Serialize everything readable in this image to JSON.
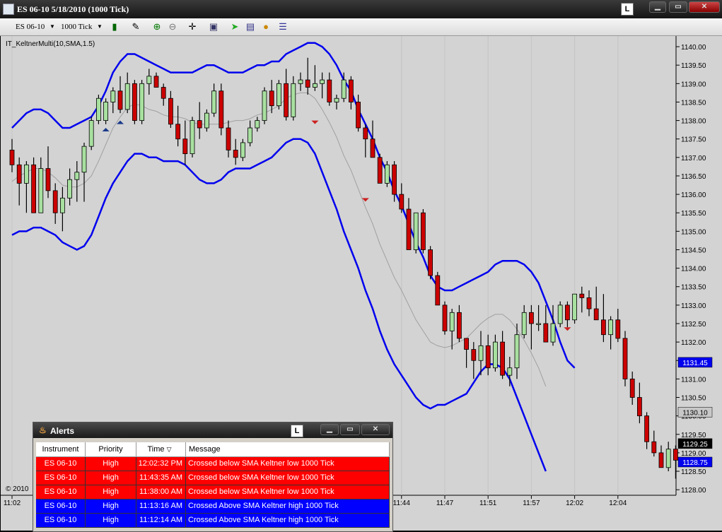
{
  "window": {
    "title": "ES 06-10  5/18/2010 (1000 Tick)",
    "lock_label": "L"
  },
  "toolbar": {
    "instrument": "ES 06-10",
    "interval": "1000 Tick"
  },
  "indicator_label": "IT_KeltnerMulti(10,SMA,1.5)",
  "copyright": "© 2010",
  "colors": {
    "up": "#a8e0a0",
    "down": "#cc0000",
    "band": "#0000ee",
    "mid": "#a0a0a0",
    "marker_up": "#1a3a8a",
    "marker_down": "#cc2222",
    "alert_red": "#ff0000",
    "alert_blue": "#0000ff",
    "chart_bg": "#d3d3d3"
  },
  "chart_data": {
    "type": "candlestick",
    "xlabel": "",
    "ylabel": "",
    "ylim": [
      1127.85,
      1140.25
    ],
    "y_ticks": [
      "1140.00",
      "1139.50",
      "1139.00",
      "1138.50",
      "1138.00",
      "1137.50",
      "1137.00",
      "1136.50",
      "1136.00",
      "1135.50",
      "1135.00",
      "1134.50",
      "1134.00",
      "1133.50",
      "1133.00",
      "1132.50",
      "1132.00",
      "1131.50",
      "1131.00",
      "1130.50",
      "1130.00",
      "1129.50",
      "1129.00",
      "1128.50",
      "1128.00"
    ],
    "x_ticks": [
      {
        "bar": 0,
        "label": "11:02"
      },
      {
        "bar": 54,
        "label": "11:44"
      },
      {
        "bar": 60,
        "label": "11:47"
      },
      {
        "bar": 66,
        "label": "11:51"
      },
      {
        "bar": 72,
        "label": "11:57"
      },
      {
        "bar": 78,
        "label": "12:02"
      },
      {
        "bar": 84,
        "label": "12:04"
      }
    ],
    "price_tags": [
      {
        "label": "1131.45",
        "value": 1131.45,
        "color": "#0000ee"
      },
      {
        "label": "1130.10",
        "value": 1130.1,
        "color": "#c8c8c8"
      },
      {
        "label": "1129.25",
        "value": 1129.25,
        "color": "#000000"
      },
      {
        "label": "1128.75",
        "value": 1128.75,
        "color": "#0000ee"
      }
    ],
    "ohlc": [
      [
        1137.2,
        1137.5,
        1136.6,
        1136.8
      ],
      [
        1136.8,
        1137.0,
        1135.7,
        1136.3
      ],
      [
        1136.3,
        1136.9,
        1135.5,
        1136.8
      ],
      [
        1136.8,
        1137.0,
        1135.5,
        1135.5
      ],
      [
        1135.5,
        1137.0,
        1135.5,
        1136.7
      ],
      [
        1136.7,
        1137.3,
        1135.9,
        1136.1
      ],
      [
        1136.1,
        1136.3,
        1135.2,
        1135.5
      ],
      [
        1135.5,
        1136.2,
        1135.0,
        1135.9
      ],
      [
        1135.9,
        1136.7,
        1135.7,
        1136.4
      ],
      [
        1136.4,
        1136.9,
        1135.8,
        1136.6
      ],
      [
        1136.6,
        1137.4,
        1135.8,
        1137.3
      ],
      [
        1137.3,
        1138.1,
        1137.2,
        1138.0
      ],
      [
        1138.0,
        1138.7,
        1137.9,
        1138.6
      ],
      [
        1138.0,
        1138.6,
        1137.9,
        1138.5
      ],
      [
        1138.5,
        1138.9,
        1138.2,
        1138.8
      ],
      [
        1138.8,
        1139.2,
        1138.2,
        1138.3
      ],
      [
        1138.3,
        1139.3,
        1138.2,
        1139.0
      ],
      [
        1139.0,
        1139.1,
        1137.9,
        1138.0
      ],
      [
        1138.0,
        1139.1,
        1137.9,
        1139.0
      ],
      [
        1139.0,
        1139.4,
        1138.7,
        1139.2
      ],
      [
        1139.2,
        1139.3,
        1138.9,
        1138.9
      ],
      [
        1138.9,
        1139.0,
        1138.4,
        1138.6
      ],
      [
        1138.6,
        1138.8,
        1137.8,
        1137.9
      ],
      [
        1137.9,
        1138.4,
        1137.3,
        1137.5
      ],
      [
        1137.5,
        1138.0,
        1136.8,
        1137.1
      ],
      [
        1137.1,
        1138.1,
        1137.0,
        1138.0
      ],
      [
        1138.0,
        1138.5,
        1137.5,
        1137.8
      ],
      [
        1137.8,
        1138.3,
        1137.7,
        1138.2
      ],
      [
        1138.2,
        1139.0,
        1138.1,
        1138.8
      ],
      [
        1138.8,
        1139.0,
        1137.6,
        1137.8
      ],
      [
        1137.8,
        1138.0,
        1137.0,
        1137.2
      ],
      [
        1137.2,
        1137.5,
        1136.8,
        1137.0
      ],
      [
        1137.0,
        1137.5,
        1136.9,
        1137.4
      ],
      [
        1137.4,
        1138.0,
        1137.3,
        1137.8
      ],
      [
        1137.8,
        1138.1,
        1137.7,
        1138.0
      ],
      [
        1138.0,
        1138.9,
        1137.9,
        1138.8
      ],
      [
        1138.8,
        1139.1,
        1138.2,
        1138.4
      ],
      [
        1138.4,
        1139.1,
        1138.3,
        1139.0
      ],
      [
        1139.0,
        1139.4,
        1138.0,
        1138.1
      ],
      [
        1138.1,
        1139.2,
        1138.0,
        1139.0
      ],
      [
        1139.0,
        1139.3,
        1138.8,
        1139.1
      ],
      [
        1139.1,
        1139.7,
        1138.7,
        1138.9
      ],
      [
        1138.9,
        1139.5,
        1138.8,
        1139.0
      ],
      [
        1139.0,
        1139.3,
        1138.6,
        1139.1
      ],
      [
        1139.1,
        1139.3,
        1138.4,
        1138.5
      ],
      [
        1138.5,
        1138.7,
        1138.3,
        1138.6
      ],
      [
        1138.6,
        1139.3,
        1138.5,
        1139.1
      ],
      [
        1139.1,
        1139.2,
        1138.3,
        1138.5
      ],
      [
        1138.5,
        1138.7,
        1137.7,
        1137.8
      ],
      [
        1137.8,
        1137.9,
        1137.0,
        1137.5
      ],
      [
        1137.5,
        1138.0,
        1137.0,
        1137.0
      ],
      [
        1137.0,
        1137.1,
        1136.3,
        1136.3
      ],
      [
        1136.3,
        1136.9,
        1136.2,
        1136.8
      ],
      [
        1136.8,
        1136.9,
        1135.8,
        1136.0
      ],
      [
        1136.0,
        1136.3,
        1135.5,
        1135.6
      ],
      [
        1135.6,
        1135.9,
        1134.5,
        1134.5
      ],
      [
        1134.5,
        1135.5,
        1134.4,
        1135.5
      ],
      [
        1135.5,
        1135.6,
        1134.4,
        1134.5
      ],
      [
        1134.5,
        1134.6,
        1133.7,
        1133.8
      ],
      [
        1133.8,
        1133.9,
        1133.0,
        1133.0
      ],
      [
        1133.0,
        1133.1,
        1132.2,
        1132.3
      ],
      [
        1132.3,
        1132.9,
        1131.8,
        1132.8
      ],
      [
        1132.8,
        1133.0,
        1132.0,
        1132.1
      ],
      [
        1132.1,
        1132.1,
        1131.3,
        1131.8
      ],
      [
        1131.8,
        1132.0,
        1131.0,
        1131.5
      ],
      [
        1131.5,
        1132.3,
        1131.1,
        1131.9
      ],
      [
        1131.9,
        1132.2,
        1131.1,
        1131.3
      ],
      [
        1131.3,
        1132.2,
        1131.2,
        1132.0
      ],
      [
        1132.0,
        1132.3,
        1131.0,
        1131.1
      ],
      [
        1131.1,
        1131.6,
        1130.8,
        1131.3
      ],
      [
        1131.3,
        1132.5,
        1131.0,
        1132.2
      ],
      [
        1132.2,
        1133.0,
        1132.1,
        1132.8
      ],
      [
        1132.8,
        1133.0,
        1131.8,
        1132.5
      ],
      [
        1132.5,
        1133.0,
        1132.3,
        1132.5
      ],
      [
        1132.5,
        1133.0,
        1132.0,
        1132.0
      ],
      [
        1132.0,
        1133.0,
        1131.9,
        1132.5
      ],
      [
        1132.5,
        1133.1,
        1132.4,
        1133.0
      ],
      [
        1133.0,
        1133.1,
        1132.4,
        1132.6
      ],
      [
        1132.6,
        1133.1,
        1132.5,
        1133.3
      ],
      [
        1133.3,
        1133.5,
        1132.8,
        1133.2
      ],
      [
        1133.2,
        1133.4,
        1132.7,
        1132.9
      ],
      [
        1132.9,
        1133.5,
        1132.7,
        1132.6
      ],
      [
        1132.6,
        1133.3,
        1132.0,
        1132.2
      ],
      [
        1132.2,
        1132.7,
        1131.8,
        1132.6
      ],
      [
        1132.6,
        1132.9,
        1132.0,
        1132.1
      ],
      [
        1132.1,
        1132.3,
        1130.8,
        1131.0
      ],
      [
        1131.0,
        1131.2,
        1130.3,
        1130.5
      ],
      [
        1130.5,
        1130.9,
        1129.8,
        1130.0
      ],
      [
        1130.0,
        1130.1,
        1129.1,
        1129.3
      ],
      [
        1129.3,
        1129.6,
        1128.9,
        1129.0
      ],
      [
        1129.0,
        1129.2,
        1128.6,
        1128.6
      ],
      [
        1128.6,
        1129.3,
        1128.5,
        1129.1
      ],
      [
        1129.1,
        1129.2,
        1128.3,
        1128.8
      ]
    ],
    "upper_band": [
      1137.8,
      1138.0,
      1138.2,
      1138.3,
      1138.3,
      1138.2,
      1138.0,
      1137.8,
      1137.8,
      1137.9,
      1138.0,
      1138.1,
      1138.4,
      1138.8,
      1139.3,
      1139.6,
      1139.8,
      1139.8,
      1139.7,
      1139.6,
      1139.5,
      1139.4,
      1139.3,
      1139.3,
      1139.3,
      1139.3,
      1139.4,
      1139.5,
      1139.5,
      1139.4,
      1139.3,
      1139.3,
      1139.3,
      1139.4,
      1139.5,
      1139.5,
      1139.6,
      1139.6,
      1139.8,
      1139.9,
      1140.0,
      1140.1,
      1140.1,
      1140.0,
      1139.8,
      1139.5,
      1139.1,
      1138.8,
      1138.3,
      1137.9,
      1137.5,
      1137.0,
      1136.6,
      1136.1,
      1135.7,
      1135.2,
      1134.7,
      1134.3,
      1133.8,
      1133.5,
      1133.4,
      1133.4,
      1133.5,
      1133.6,
      1133.7,
      1133.8,
      1133.9,
      1134.1,
      1134.2,
      1134.2,
      1134.2,
      1134.1,
      1133.9,
      1133.6,
      1133.1,
      1132.6,
      1132.0,
      1131.5,
      1131.3
    ],
    "lower_band": [
      1134.9,
      1135.0,
      1135.0,
      1135.1,
      1135.1,
      1135.0,
      1134.9,
      1134.7,
      1134.6,
      1134.5,
      1134.6,
      1134.9,
      1135.4,
      1135.9,
      1136.3,
      1136.6,
      1136.9,
      1137.1,
      1137.1,
      1137.0,
      1137.0,
      1136.9,
      1136.9,
      1136.9,
      1136.8,
      1136.6,
      1136.4,
      1136.3,
      1136.3,
      1136.4,
      1136.6,
      1136.7,
      1136.7,
      1136.7,
      1136.8,
      1136.9,
      1137.0,
      1137.2,
      1137.4,
      1137.5,
      1137.5,
      1137.4,
      1137.1,
      1136.6,
      1136.1,
      1135.6,
      1135.0,
      1134.5,
      1134.0,
      1133.4,
      1132.9,
      1132.3,
      1131.8,
      1131.4,
      1131.1,
      1130.8,
      1130.5,
      1130.3,
      1130.2,
      1130.3,
      1130.3,
      1130.4,
      1130.5,
      1130.6,
      1130.9,
      1131.2,
      1131.4,
      1131.4,
      1131.3,
      1131.0,
      1130.5,
      1130.0,
      1129.5,
      1129.0,
      1128.5
    ]
  },
  "alerts": {
    "title": "Alerts",
    "lock_label": "L",
    "columns": [
      "Instrument",
      "Priority",
      "Time",
      "Message"
    ],
    "rows": [
      {
        "instrument": "ES 06-10",
        "priority": "High",
        "time": "12:02:32 PM",
        "message": "Crossed below SMA Keltner low 1000 Tick",
        "color": "#ff0000"
      },
      {
        "instrument": "ES 06-10",
        "priority": "High",
        "time": "11:43:35 AM",
        "message": "Crossed below SMA Keltner low 1000 Tick",
        "color": "#ff0000"
      },
      {
        "instrument": "ES 06-10",
        "priority": "High",
        "time": "11:38:00 AM",
        "message": "Crossed below SMA Keltner low 1000 Tick",
        "color": "#ff0000"
      },
      {
        "instrument": "ES 06-10",
        "priority": "High",
        "time": "11:13:16 AM",
        "message": "Crossed Above SMA Keltner high 1000 Tick",
        "color": "#0000ff"
      },
      {
        "instrument": "ES 06-10",
        "priority": "High",
        "time": "11:12:14 AM",
        "message": "Crossed Above SMA Keltner high 1000 Tick",
        "color": "#0000ff"
      }
    ]
  }
}
